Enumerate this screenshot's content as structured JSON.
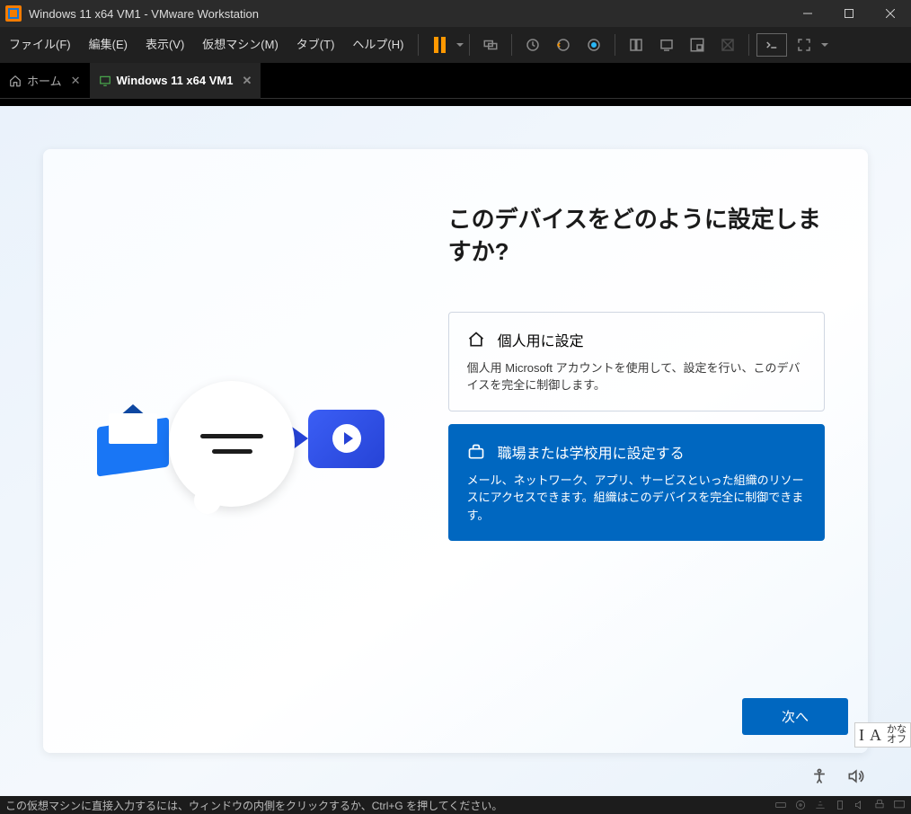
{
  "titlebar": {
    "title": "Windows 11 x64 VM1 - VMware Workstation"
  },
  "menubar": {
    "items": [
      "ファイル(F)",
      "編集(E)",
      "表示(V)",
      "仮想マシン(M)",
      "タブ(T)",
      "ヘルプ(H)"
    ]
  },
  "tabs": {
    "home": "ホーム",
    "vm": "Windows 11 x64 VM1"
  },
  "oobe": {
    "title": "このデバイスをどのように設定しますか?",
    "option_personal": {
      "title": "個人用に設定",
      "desc": "個人用 Microsoft アカウントを使用して、設定を行い、このデバイスを完全に制御します。"
    },
    "option_work": {
      "title": "職場または学校用に設定する",
      "desc": "メール、ネットワーク、アプリ、サービスといった組織のリソースにアクセスできます。組織はこのデバイスを完全に制御できます。"
    },
    "next": "次へ"
  },
  "ime": {
    "line1": "かな",
    "line2": "オフ"
  },
  "statusbar": {
    "message": "この仮想マシンに直接入力するには、ウィンドウの内側をクリックするか、Ctrl+G を押してください。"
  }
}
